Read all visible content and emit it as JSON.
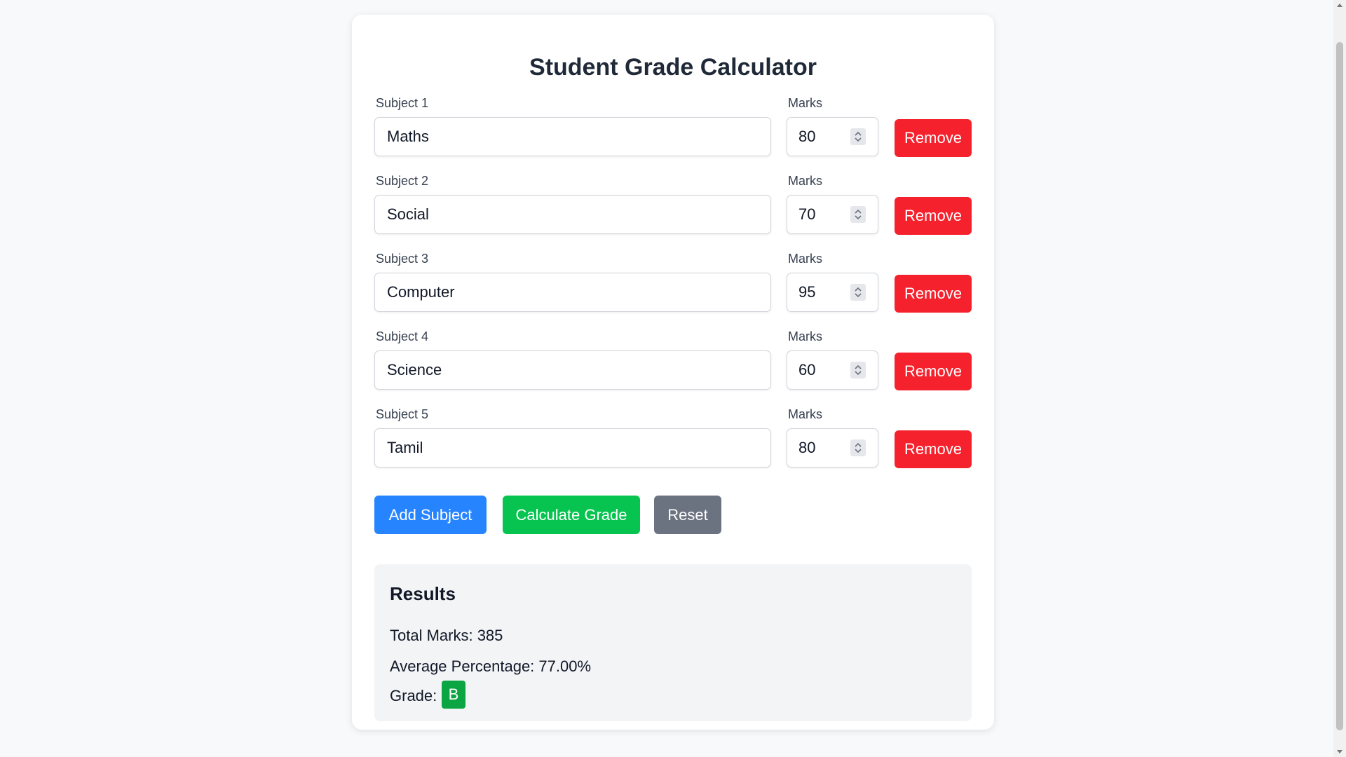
{
  "app": {
    "title": "Student Grade Calculator"
  },
  "subjects": [
    {
      "label": "Subject 1",
      "name": "Maths",
      "marks_label": "Marks",
      "marks": "80",
      "remove_label": "Remove"
    },
    {
      "label": "Subject 2",
      "name": "Social",
      "marks_label": "Marks",
      "marks": "70",
      "remove_label": "Remove"
    },
    {
      "label": "Subject 3",
      "name": "Computer",
      "marks_label": "Marks",
      "marks": "95",
      "remove_label": "Remove"
    },
    {
      "label": "Subject 4",
      "name": "Science",
      "marks_label": "Marks",
      "marks": "60",
      "remove_label": "Remove"
    },
    {
      "label": "Subject 5",
      "name": "Tamil",
      "marks_label": "Marks",
      "marks": "80",
      "remove_label": "Remove"
    }
  ],
  "actions": {
    "add_label": "Add Subject",
    "calculate_label": "Calculate Grade",
    "reset_label": "Reset"
  },
  "results": {
    "title": "Results",
    "total_line": "Total Marks: 385",
    "average_line": "Average Percentage: 77.00%",
    "grade_label": "Grade:",
    "grade": "B"
  },
  "colors": {
    "remove": "#f5222d",
    "add": "#2684ff",
    "calculate": "#06c44f",
    "reset": "#6b7280",
    "grade_badge": "#0ca543"
  },
  "icons": {
    "marks_stepper": "spinner-up-down-icon"
  }
}
